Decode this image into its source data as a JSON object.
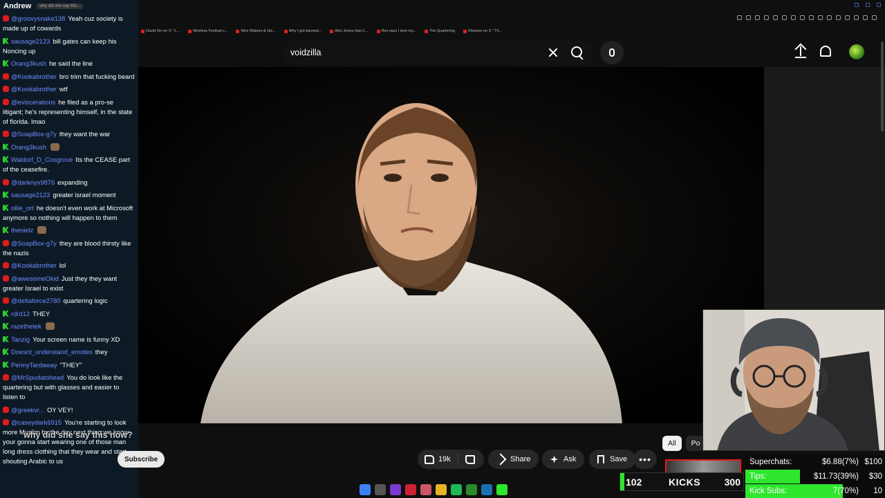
{
  "chat": {
    "header_name": "Andrew",
    "header_tab": "why did she say this...",
    "messages": [
      {
        "platform": "youtube",
        "user": "@groovysnake138",
        "text": "Yeah cuz society is made up of cowards"
      },
      {
        "platform": "kick",
        "user": "sausage2123",
        "text": "bill gates can keep his Noncing up"
      },
      {
        "platform": "kick",
        "user": "Orang3kush",
        "text": "he said the line"
      },
      {
        "platform": "youtube",
        "user": "@Kookabrother",
        "text": "bro trim that fucking beard"
      },
      {
        "platform": "youtube",
        "user": "@Kookabrother",
        "text": "wtf"
      },
      {
        "platform": "youtube",
        "user": "@eviscerations",
        "text": "he filed as a pro-se litigant; he's representing himself, in the state of florida. lmao"
      },
      {
        "platform": "youtube",
        "user": "@SoapBox-g7y",
        "text": "they want the war"
      },
      {
        "platform": "kick",
        "user": "Orang3kush",
        "text": ""
      },
      {
        "platform": "kick",
        "user": "Waldorf_D_Cosgrove",
        "text": "Its the CEASE part of the ceasefire."
      },
      {
        "platform": "youtube",
        "user": "@darknyx9876",
        "text": "expanding"
      },
      {
        "platform": "kick",
        "user": "sausage2123",
        "text": "greater israel moment"
      },
      {
        "platform": "kick",
        "user": "ollie_ort",
        "text": "he doesn't even work at Microsoft anymore so nothing will happen to them"
      },
      {
        "platform": "kick",
        "user": "thenielz",
        "text": ""
      },
      {
        "platform": "youtube",
        "user": "@SoapBox-g7y",
        "text": "they are blood thirsty like the nazis"
      },
      {
        "platform": "youtube",
        "user": "@Kookabrother",
        "text": "lol"
      },
      {
        "platform": "youtube",
        "user": "@awesomeOkid",
        "text": "Just they they want greater Israel to exist"
      },
      {
        "platform": "youtube",
        "user": "@deltaforce2780",
        "text": "quartering logic"
      },
      {
        "platform": "kick",
        "user": "rdrd12",
        "text": "THEY"
      },
      {
        "platform": "kick",
        "user": "razethetek",
        "text": ""
      },
      {
        "platform": "kick",
        "user": "Tanzig",
        "text": "Your screen name is funny XD"
      },
      {
        "platform": "kick",
        "user": "Doesnt_understand_emotes",
        "text": "they"
      },
      {
        "platform": "kick",
        "user": "PennyTardaway",
        "text": "\"THEY\""
      },
      {
        "platform": "youtube",
        "user": "@MrSpudatohead",
        "text": "You do look like the quartering but with glasses and easier to listen to"
      },
      {
        "platform": "youtube",
        "user": "@greekvr...",
        "text": "OY VEY!"
      },
      {
        "platform": "youtube",
        "user": "@caseydark6915",
        "text": "You're starting to look more Muslim by the day next thing we know your gonna start wearing one of those man long dress clothing that they wear and start shouting Arabic to us"
      }
    ]
  },
  "bookmarks": [
    "David Orr on X: \"L...",
    "Wireless Festival c...",
    "Wes Watson & His...",
    "Why I got banned...",
    "Alex Jones Has C...",
    "Rev says I love my...",
    "The Quartering",
    "Shamoo on X: \"Th..."
  ],
  "youtube": {
    "search_value": "voidzilla",
    "video_title_overlay": "why did she say this now?",
    "subscribe_label": "Subscribe",
    "like_count": "19k",
    "share_label": "Share",
    "ask_label": "Ask",
    "save_label": "Save",
    "chips": [
      "All",
      "Po"
    ]
  },
  "stream_overlay": {
    "kicks_count": "102",
    "kicks_label": "KICKS",
    "kicks_goal": "300",
    "stats": [
      {
        "label": "Superchats:",
        "value": "$6.88(7%)",
        "goal": "$100",
        "fraction": 0.0
      },
      {
        "label": "Tips:",
        "value": "$11.73(39%)",
        "goal": "$30",
        "fraction": 0.39
      },
      {
        "label": "Kick Subs:",
        "value": "7(70%)",
        "goal": "10",
        "fraction": 0.7
      }
    ]
  },
  "colors": {
    "accent_green": "#2ee62e",
    "youtube_red": "#e01b1b"
  }
}
